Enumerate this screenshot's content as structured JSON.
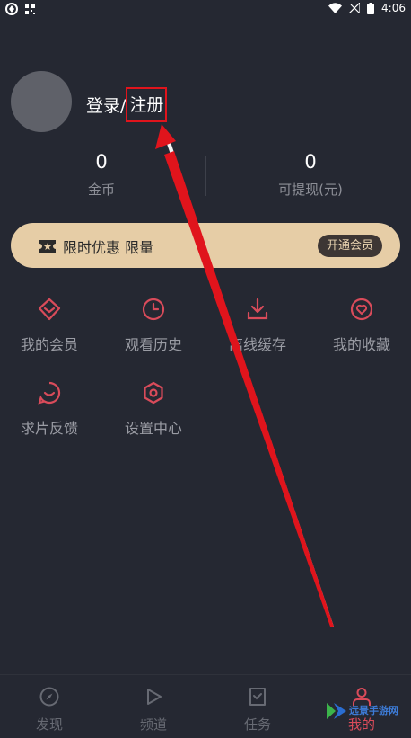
{
  "status_bar": {
    "time": "4:06"
  },
  "profile": {
    "login_label": "登录/",
    "register_label": "注册"
  },
  "stats": [
    {
      "value": "0",
      "label": "金币"
    },
    {
      "value": "0",
      "label": "可提现(元)"
    }
  ],
  "promo": {
    "text": "限时优惠 限量",
    "button": "开通会员"
  },
  "menu": [
    {
      "label": "我的会员",
      "icon": "diamond-icon"
    },
    {
      "label": "观看历史",
      "icon": "clock-icon"
    },
    {
      "label": "离线缓存",
      "icon": "download-icon"
    },
    {
      "label": "我的收藏",
      "icon": "heart-icon"
    },
    {
      "label": "求片反馈",
      "icon": "smile-icon"
    },
    {
      "label": "设置中心",
      "icon": "gear-icon"
    }
  ],
  "tabs": [
    {
      "label": "发现",
      "icon": "compass-icon",
      "active": false
    },
    {
      "label": "频道",
      "icon": "play-icon",
      "active": false
    },
    {
      "label": "任务",
      "icon": "task-icon",
      "active": false
    },
    {
      "label": "我的",
      "icon": "user-icon",
      "active": true
    }
  ],
  "colors": {
    "background": "#252832",
    "accent": "#d94b5a",
    "promo_bg": "#e6cda6",
    "annotation_red": "#e0141c"
  },
  "watermark": {
    "text": "远景手游网"
  }
}
